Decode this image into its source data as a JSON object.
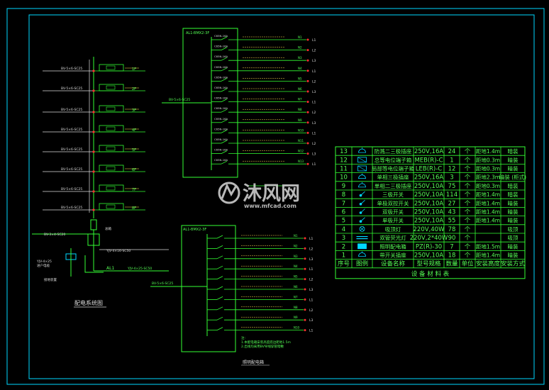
{
  "colors": {
    "background": "#000000",
    "frame": "#00d8ff",
    "line": "#33ff33",
    "text_white": "#dddddd",
    "accent_red": "#ff3030",
    "accent_yellow": "#ffe14d",
    "watermark": "#c8c8c8"
  },
  "diagrams": {
    "left_title": "配电系统图",
    "right_title": "照明配电箱",
    "top_panel_label": "AL1-BMX2-3F",
    "bottom_panel_label": "AL1-BMX2-3F"
  },
  "watermark": {
    "brand": "沐风网",
    "url": "www.mfcad.com"
  },
  "table": {
    "title": "设 备 材 料 表",
    "headers": [
      "序号",
      "图例",
      "设备名称",
      "型号规格",
      "数量",
      "单位",
      "安装高度",
      "安装方式"
    ],
    "rows": [
      {
        "no": "13",
        "icon": "socket-icon",
        "name": "防溅二三极插座",
        "model": "250V,16A",
        "qty": "24",
        "unit": "个",
        "height": "距地1.4m",
        "mount": "暗装"
      },
      {
        "no": "12",
        "icon": "junction-icon",
        "name": "总等电位端子箱",
        "model": "MEB(R)-C",
        "qty": "1",
        "unit": "个",
        "height": "距地0.3m",
        "mount": "暗装"
      },
      {
        "no": "11",
        "icon": "box-icon",
        "name": "局部等电位端子箱",
        "model": "LEB(R)-C",
        "qty": "12",
        "unit": "个",
        "height": "距地0.3m",
        "mount": "暗装"
      },
      {
        "no": "10",
        "icon": "socket-icon",
        "name": "单相三极插座",
        "model": "250V,16A",
        "qty": "3",
        "unit": "个",
        "height": "距地2.3m",
        "mount": "暗装 (柜式)"
      },
      {
        "no": "9",
        "icon": "socket-icon",
        "name": "单相二三极插座",
        "model": "250V,10A",
        "qty": "75",
        "unit": "个",
        "height": "距地0.3m",
        "mount": "暗装"
      },
      {
        "no": "8",
        "icon": "switch-icon",
        "name": "三极开关",
        "model": "250V,10A",
        "qty": "114",
        "unit": "个",
        "height": "距地1.4m",
        "mount": "暗装"
      },
      {
        "no": "7",
        "icon": "switch-icon",
        "name": "单极双控开关",
        "model": "250V,10A",
        "qty": "27",
        "unit": "个",
        "height": "距地1.4m",
        "mount": "暗装"
      },
      {
        "no": "6",
        "icon": "switch-icon",
        "name": "双极开关",
        "model": "250V,10A",
        "qty": "43",
        "unit": "个",
        "height": "距地1.4m",
        "mount": "暗装"
      },
      {
        "no": "5",
        "icon": "switch-icon",
        "name": "单极开关",
        "model": "250V,10A",
        "qty": "55",
        "unit": "个",
        "height": "距地1.4m",
        "mount": "暗装"
      },
      {
        "no": "4",
        "icon": "ceiling-lamp-icon",
        "name": "吸顶灯",
        "model": "220V,40W",
        "qty": "78",
        "unit": "个",
        "height": "",
        "mount": "吸顶"
      },
      {
        "no": "3",
        "icon": "fluorescent-icon",
        "name": "双管荧光灯",
        "model": "220V,2*40W",
        "qty": "90",
        "unit": "个",
        "height": "",
        "mount": "吸顶"
      },
      {
        "no": "2",
        "icon": "panel-icon",
        "name": "照明配电箱",
        "model": "PZ(R)-30",
        "qty": "7",
        "unit": "个",
        "height": "距地1.5m",
        "mount": "暗装"
      },
      {
        "no": "1",
        "icon": "socket-icon",
        "name": "带开关插座",
        "model": "250V,10A",
        "qty": "18",
        "unit": "个",
        "height": "距地1.4m",
        "mount": "暗装"
      }
    ]
  }
}
